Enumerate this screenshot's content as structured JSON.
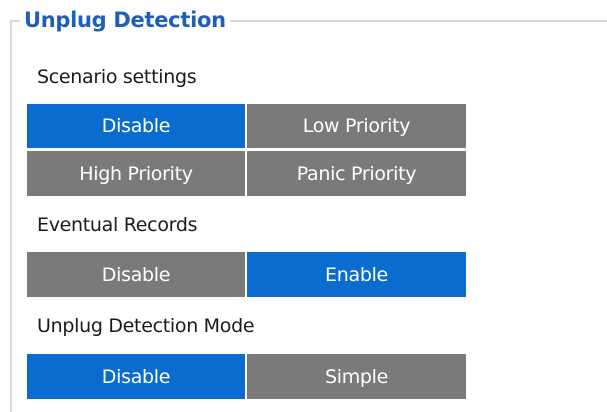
{
  "group": {
    "title": "Unplug Detection"
  },
  "colors": {
    "title": "#1f5fb8",
    "selected": "#0a6ccf",
    "unselected": "#7a7a7a",
    "border": "#d9d9d9"
  },
  "scenario_settings": {
    "label": "Scenario settings",
    "options": [
      "Disable",
      "Low Priority",
      "High Priority",
      "Panic Priority"
    ],
    "selected": "Disable"
  },
  "eventual_records": {
    "label": "Eventual Records",
    "options": [
      "Disable",
      "Enable"
    ],
    "selected": "Enable"
  },
  "unplug_detection_mode": {
    "label": "Unplug Detection Mode",
    "options": [
      "Disable",
      "Simple"
    ],
    "selected": "Disable"
  }
}
